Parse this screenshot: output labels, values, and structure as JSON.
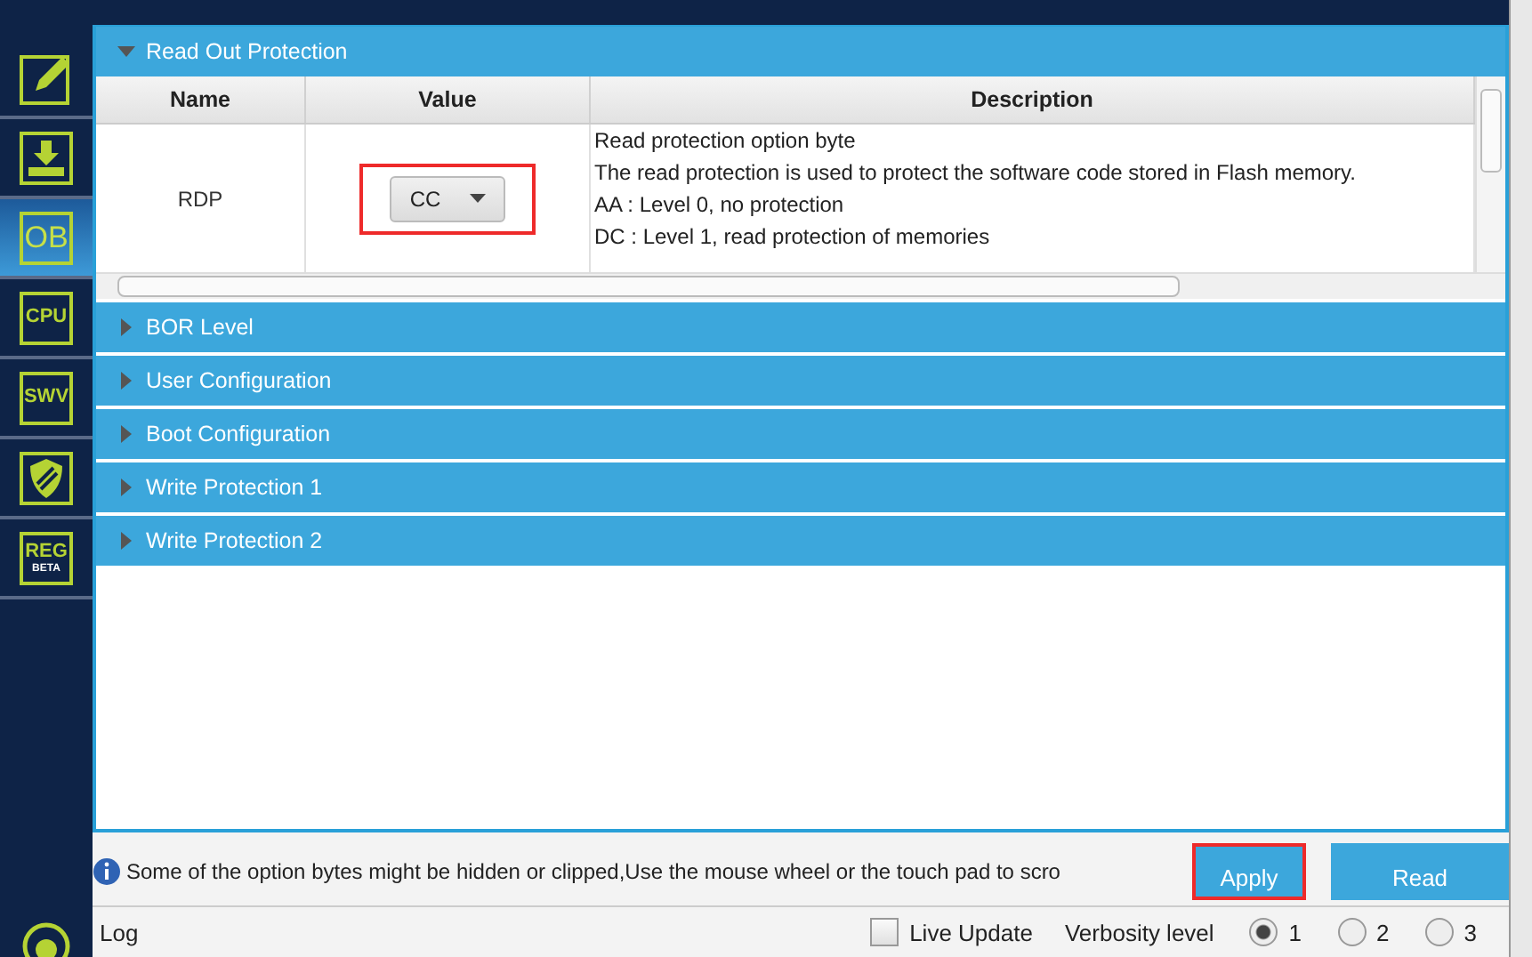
{
  "sidebar": {
    "items": [
      {
        "kind": "pencil",
        "selected": false
      },
      {
        "kind": "download",
        "selected": false
      },
      {
        "kind": "text",
        "label": "OB",
        "selected": true
      },
      {
        "kind": "text",
        "label": "CPU",
        "selected": false
      },
      {
        "kind": "text",
        "label": "SWV",
        "selected": false
      },
      {
        "kind": "shield",
        "selected": false
      },
      {
        "kind": "text",
        "label": "REG",
        "sublabel": "BETA",
        "selected": false
      }
    ]
  },
  "sections": [
    {
      "title": "Read Out Protection",
      "expanded": true,
      "table": {
        "columns": [
          "Name",
          "Value",
          "Description"
        ],
        "rows": [
          {
            "name": "RDP",
            "value": "CC",
            "highlighted": true,
            "description": [
              "Read protection option byte",
              "The read protection is used to protect the software code stored in Flash memory.",
              "AA : Level 0, no protection",
              "DC : Level 1, read protection of memories"
            ]
          }
        ]
      }
    },
    {
      "title": "BOR Level",
      "expanded": false
    },
    {
      "title": "User Configuration",
      "expanded": false
    },
    {
      "title": "Boot Configuration",
      "expanded": false
    },
    {
      "title": "Write Protection 1",
      "expanded": false
    },
    {
      "title": "Write Protection 2",
      "expanded": false
    }
  ],
  "info": "Some of the option bytes might be hidden or clipped,Use the mouse wheel or the touch pad to scro",
  "buttons": [
    {
      "label": "Apply",
      "highlighted": true
    },
    {
      "label": "Read",
      "highlighted": false
    }
  ],
  "log": {
    "title": "Log",
    "live_update": {
      "label": "Live Update",
      "checked": false
    },
    "verbosity_label": "Verbosity level",
    "levels": [
      {
        "label": "1",
        "selected": true
      },
      {
        "label": "2",
        "selected": false
      },
      {
        "label": "3",
        "selected": false
      }
    ]
  }
}
